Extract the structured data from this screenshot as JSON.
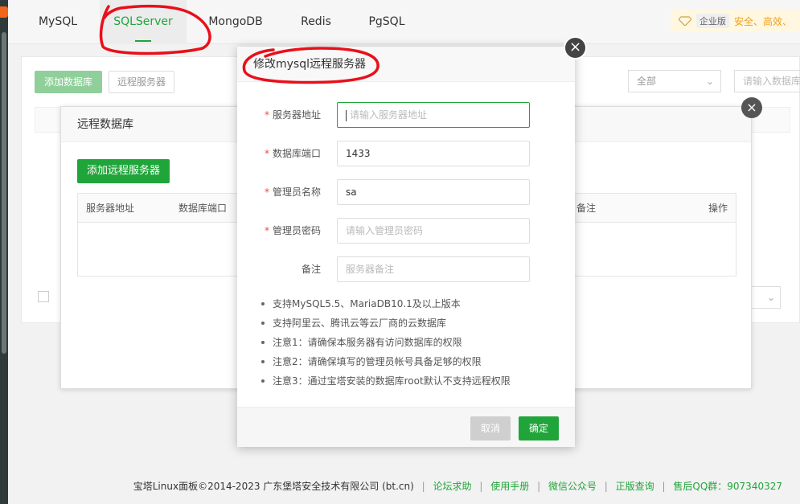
{
  "tabs": [
    {
      "label": "MySQL"
    },
    {
      "label": "SQLServer"
    },
    {
      "label": "MongoDB"
    },
    {
      "label": "Redis"
    },
    {
      "label": "PgSQL"
    }
  ],
  "enterprise": {
    "tag": "企业版",
    "promo": "安全、高效、"
  },
  "background": {
    "add_db_label": "添加数据库",
    "remote_server_label": "远程服务器",
    "filter_value": "全部",
    "search_placeholder": "请输入数据库"
  },
  "remote_dialog": {
    "title": "远程数据库",
    "add_button": "添加远程服务器",
    "columns": [
      "服务器地址",
      "数据库端口",
      "备注",
      "操作"
    ]
  },
  "modal": {
    "title": "修改mysql远程服务器",
    "fields": [
      {
        "label": "服务器地址",
        "required": true,
        "value": "",
        "placeholder": "请输入服务器地址"
      },
      {
        "label": "数据库端口",
        "required": true,
        "value": "1433",
        "placeholder": ""
      },
      {
        "label": "管理员名称",
        "required": true,
        "value": "sa",
        "placeholder": ""
      },
      {
        "label": "管理员密码",
        "required": true,
        "value": "",
        "placeholder": "请输入管理员密码"
      },
      {
        "label": "备注",
        "required": false,
        "value": "",
        "placeholder": "服务器备注"
      }
    ],
    "tips": [
      "支持MySQL5.5、MariaDB10.1及以上版本",
      "支持阿里云、腾讯云等云厂商的云数据库",
      "注意1：请确保本服务器有访问数据库的权限",
      "注意2：请确保填写的管理员帐号具备足够的权限",
      "注意3：通过宝塔安装的数据库root默认不支持远程权限"
    ],
    "cancel_label": "取消",
    "ok_label": "确定",
    "required_mark": "*"
  },
  "footer": {
    "copyright": "宝塔Linux面板©2014-2023 广东堡塔安全技术有限公司 (bt.cn)",
    "links": [
      "论坛求助",
      "使用手册",
      "微信公众号",
      "正版查询",
      "售后QQ群：907340327"
    ]
  },
  "colors": {
    "accent": "#20a53a",
    "annotation": "#e8101a"
  }
}
